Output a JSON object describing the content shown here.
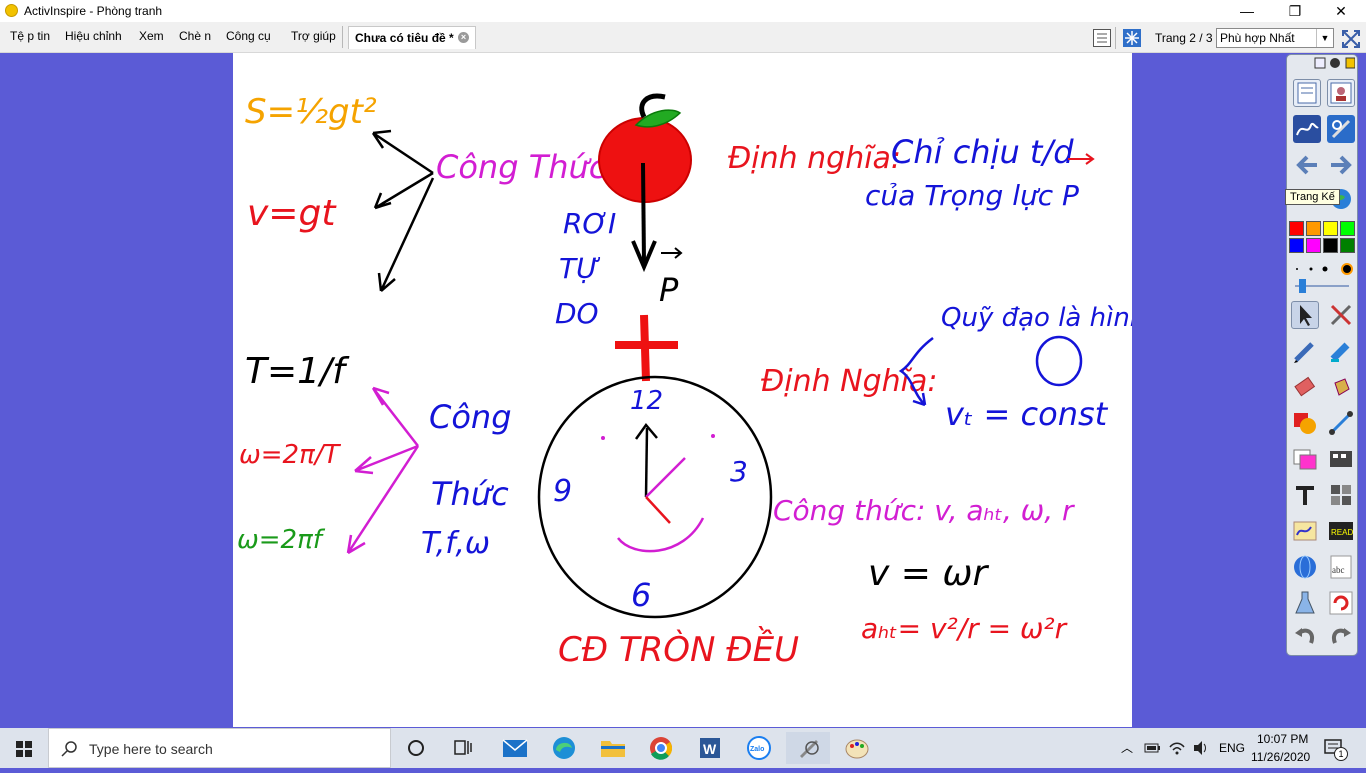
{
  "window": {
    "title": "ActivInspire - Phòng tranh",
    "minimize": "—",
    "maximize": "❐",
    "close": "✕"
  },
  "menu": [
    "Tệ p tin",
    "Hiệu chỉnh",
    "Xem",
    "Chè n",
    "Công cụ",
    "Trợ giúp"
  ],
  "document_tab": {
    "label": "Chưa có tiêu đề *"
  },
  "page_info": "Trang 2 / 3",
  "zoom": {
    "value": "Phù hợp Nhất"
  },
  "tooltip": "Trang Kế",
  "palette": {
    "colors": [
      "#ff0000",
      "#ff9900",
      "#ffff00",
      "#00ff00",
      "#0000ff",
      "#ff00ff",
      "#000000",
      "#008000"
    ]
  },
  "board": {
    "formula_s": "S=½gt²",
    "formula_v": "v=gt",
    "cong_thuc_1": "Công Thức",
    "apple_label": "RƠI TỰ DO",
    "definition_label": "Định nghĩa:",
    "definition_text": "Chỉ chịu t/d",
    "definition_text2": "của Trọng lực P",
    "p_label": "P",
    "plus": "+",
    "T_formula": "T=1/f",
    "omega1": "ω=2π/T",
    "omega2": "ω=2πf",
    "cong_thuc_2a": "Công",
    "cong_thuc_2b": "Thức",
    "cong_thuc_2c": "T,f,ω",
    "clock_12": "12",
    "clock_3": "3",
    "clock_9": "9",
    "clock_6": "6",
    "definition2_label": "Định Nghĩa:",
    "orbit_text": "Quỹ đạo là hình",
    "vt_const": "vₜ = const",
    "cong_thuc_3": "Công thức: v, aₕₜ, ω, r",
    "v_eq": "v = ωr",
    "aht_eq": "aₕₜ= v²/r = ω²r",
    "title_bottom": "CĐ TRÒN ĐỀU"
  },
  "taskbar": {
    "search_placeholder": "Type here to search",
    "time": "10:07 PM",
    "date": "11/26/2020",
    "lang": "ENG",
    "notification_count": "1",
    "apps": [
      "task-view",
      "mail",
      "edge",
      "file-explorer",
      "chrome",
      "word",
      "zalo",
      "activinspire",
      "paint"
    ]
  }
}
